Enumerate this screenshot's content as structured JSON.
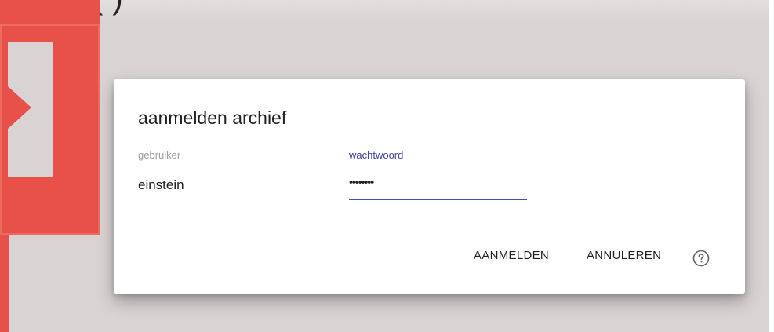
{
  "background": {
    "heading_fragment": "(                                      )"
  },
  "dialog": {
    "title": "aanmelden archief",
    "username": {
      "label": "gebruiker",
      "value": "einstein"
    },
    "password": {
      "label": "wachtwoord",
      "masked_value": "••••••••"
    },
    "actions": {
      "login_label": "AANMELDEN",
      "cancel_label": "ANNULEREN"
    },
    "help_icon": "help-circle-icon"
  },
  "colors": {
    "accent": "#3f51b5",
    "brand_red": "#e8514a",
    "backdrop": "#d9d4d3"
  }
}
